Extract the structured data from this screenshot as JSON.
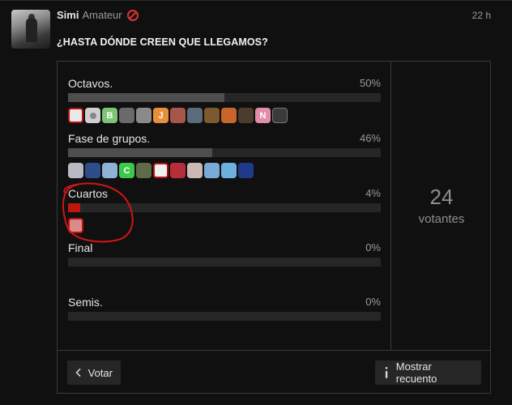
{
  "post": {
    "username": "Simi",
    "user_title": "Amateur",
    "time": "22 h",
    "title": "¿HASTA DÓNDE CREEN QUE LLEGAMOS?"
  },
  "poll": {
    "options": [
      {
        "label": "Octavos.",
        "percent_text": "50%",
        "percent": 50,
        "voter_count": 13
      },
      {
        "label": "Fase de grupos.",
        "percent_text": "46%",
        "percent": 46,
        "voter_count": 11
      },
      {
        "label": "Cuartos",
        "percent_text": "4%",
        "percent": 4,
        "voter_count": 1
      },
      {
        "label": "Final",
        "percent_text": "0%",
        "percent": 0,
        "voter_count": 0
      },
      {
        "label": "Semis.",
        "percent_text": "0%",
        "percent": 0,
        "voter_count": 0
      }
    ],
    "voters_total": "24",
    "voters_label": "votantes",
    "vote_button": "Votar",
    "results_button": "Mostrar recuento",
    "letter_avatars": {
      "octavos_b": "B",
      "octavos_j": "J",
      "octavos_n": "N",
      "grupos_c": "C"
    }
  },
  "colors": {
    "accent_red": "#c0160f",
    "annotation_circle": "#d0151a"
  },
  "icons": [
    "chevron-left-icon",
    "info-icon",
    "no-entry-icon"
  ]
}
